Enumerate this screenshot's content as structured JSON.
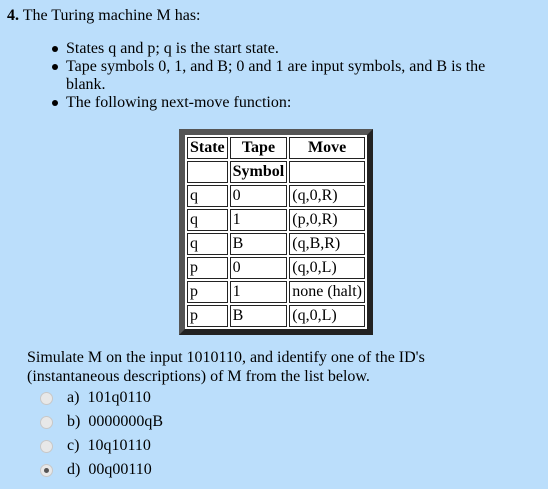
{
  "question": {
    "number": "4.",
    "text": "The Turing machine M has:"
  },
  "bullets": [
    "States q and p; q is the start state.",
    "Tape symbols 0, 1, and B; 0 and 1 are input symbols, and B is the blank.",
    "The following next-move function:"
  ],
  "table": {
    "headers": {
      "state": "State",
      "tape": "Tape",
      "tape_sub": "Symbol",
      "move": "Move"
    },
    "rows": [
      {
        "state": "q",
        "symbol": "0",
        "move": "(q,0,R)"
      },
      {
        "state": "q",
        "symbol": "1",
        "move": "(p,0,R)"
      },
      {
        "state": "q",
        "symbol": "B",
        "move": "(q,B,R)"
      },
      {
        "state": "p",
        "symbol": "0",
        "move": "(q,0,L)"
      },
      {
        "state": "p",
        "symbol": "1",
        "move": "none (halt)"
      },
      {
        "state": "p",
        "symbol": "B",
        "move": "(q,0,L)"
      }
    ]
  },
  "prompt": "Simulate M on the input 1010110, and identify one of the ID's (instantaneous descriptions) of M from the list below.",
  "options": [
    {
      "letter": "a)",
      "text": "101q0110",
      "selected": false
    },
    {
      "letter": "b)",
      "text": "0000000qB",
      "selected": false
    },
    {
      "letter": "c)",
      "text": "10q10110",
      "selected": false
    },
    {
      "letter": "d)",
      "text": "00q00110",
      "selected": true
    }
  ]
}
